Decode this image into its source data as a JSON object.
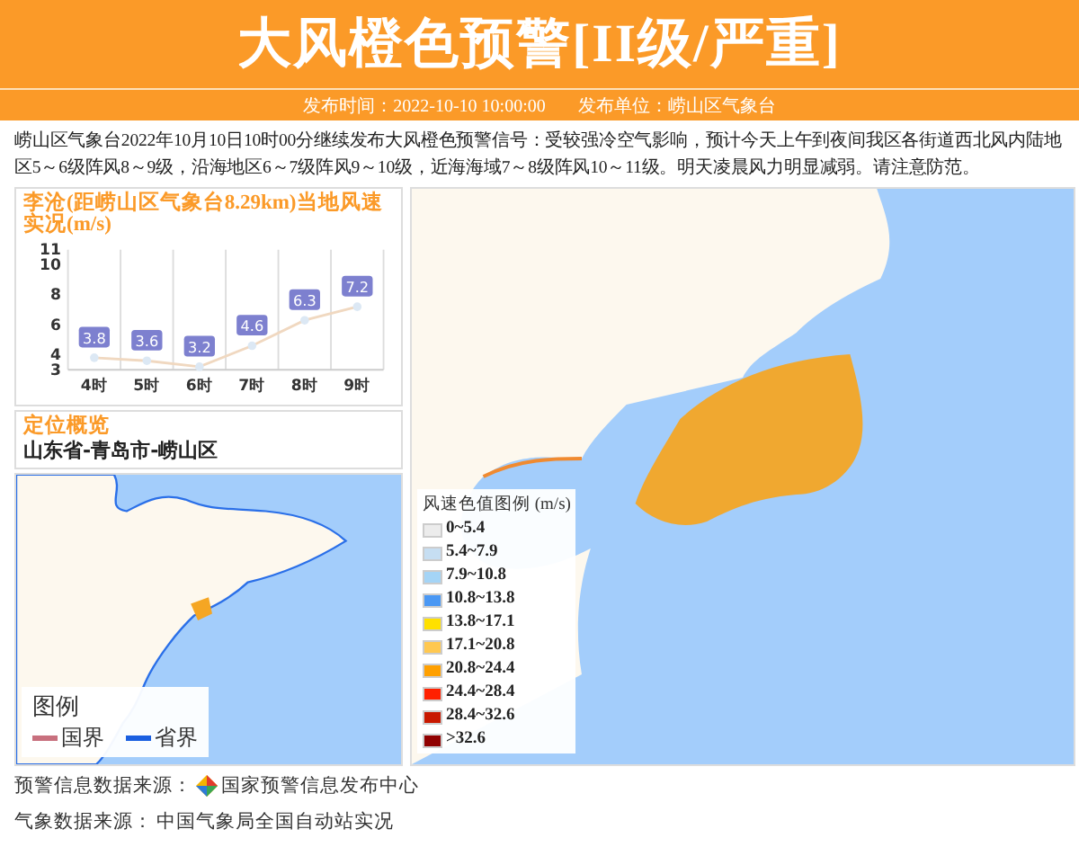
{
  "header": {
    "title": "大风橙色预警[II级/严重]",
    "issue_time_label": "发布时间：",
    "issue_time": "2022-10-10 10:00:00",
    "issuer_label": "发布单位：",
    "issuer": "崂山区气象台"
  },
  "message": "崂山区气象台2022年10月10日10时00分继续发布大风橙色预警信号：受较强冷空气影响，预计今天上午到夜间我区各街道西北风内陆地区5～6级阵风8～9级，沿海地区6～7级阵风9～10级，近海海域7～8级阵风10～11级。明天凌晨风力明显减弱。请注意防范。",
  "wind_panel": {
    "title": "李沧(距崂山区气象台8.29km)当地风速实况(m/s)",
    "chart_data": {
      "type": "line",
      "categories": [
        "4时",
        "5时",
        "6时",
        "7时",
        "8时",
        "9时"
      ],
      "series": [
        {
          "color": "#f0d8c0",
          "marker": true,
          "values": [
            3.8,
            3.6,
            3.2,
            4.6,
            6.3,
            7.2
          ]
        }
      ],
      "ylim": [
        3,
        11
      ],
      "yticks": [
        3,
        4,
        6,
        8,
        10,
        11
      ],
      "data_labels": true
    }
  },
  "location_panel": {
    "title": "定位概览",
    "region": "山东省-青岛市-崂山区",
    "legend_title": "图例",
    "legend": [
      {
        "label": "国界",
        "color": "#c8707e"
      },
      {
        "label": "省界",
        "color": "#1a5fe0"
      }
    ]
  },
  "wind_map": {
    "legend_title": "风速色值图例 (m/s)",
    "legend": [
      {
        "label": "0~5.4",
        "color": "#ececec"
      },
      {
        "label": "5.4~7.9",
        "color": "#c6def2"
      },
      {
        "label": "7.9~10.8",
        "color": "#a4d4f6"
      },
      {
        "label": "10.8~13.8",
        "color": "#4a98f4"
      },
      {
        "label": "13.8~17.1",
        "color": "#ffe000"
      },
      {
        "label": "17.1~20.8",
        "color": "#ffc850"
      },
      {
        "label": "20.8~24.4",
        "color": "#ffa000"
      },
      {
        "label": "24.4~28.4",
        "color": "#ff2000"
      },
      {
        "label": "28.4~32.6",
        "color": "#c81800"
      },
      {
        "label": ">32.6",
        "color": "#900000"
      }
    ]
  },
  "sources": [
    {
      "label": "预警信息数据来源：",
      "value": "国家预警信息发布中心",
      "kind": "logo"
    },
    {
      "label": "气象数据来源：",
      "value": "中国气象局全国自动站实况",
      "kind": "plain"
    }
  ]
}
